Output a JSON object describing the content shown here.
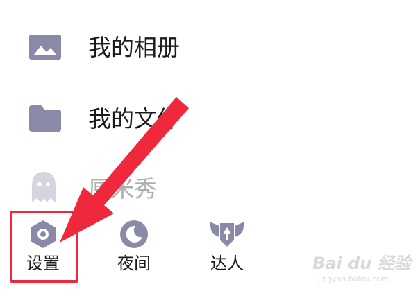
{
  "menu": {
    "items": [
      {
        "label": "我的相册",
        "icon": "image-icon"
      },
      {
        "label": "我的文件",
        "icon": "folder-icon"
      },
      {
        "label": "厘米秀",
        "icon": "ghost-icon"
      }
    ]
  },
  "bottom_bar": {
    "items": [
      {
        "label": "设置",
        "icon": "settings-hexagon-icon"
      },
      {
        "label": "夜间",
        "icon": "moon-icon"
      },
      {
        "label": "达人",
        "icon": "winged-badge-icon"
      }
    ]
  },
  "watermark": {
    "brand": "Bai du 经验",
    "url": "jingyan.baidu.com"
  },
  "colors": {
    "icon": "#8a8aa8",
    "annotation": "#f0283c",
    "text": "#1b1b1b"
  }
}
